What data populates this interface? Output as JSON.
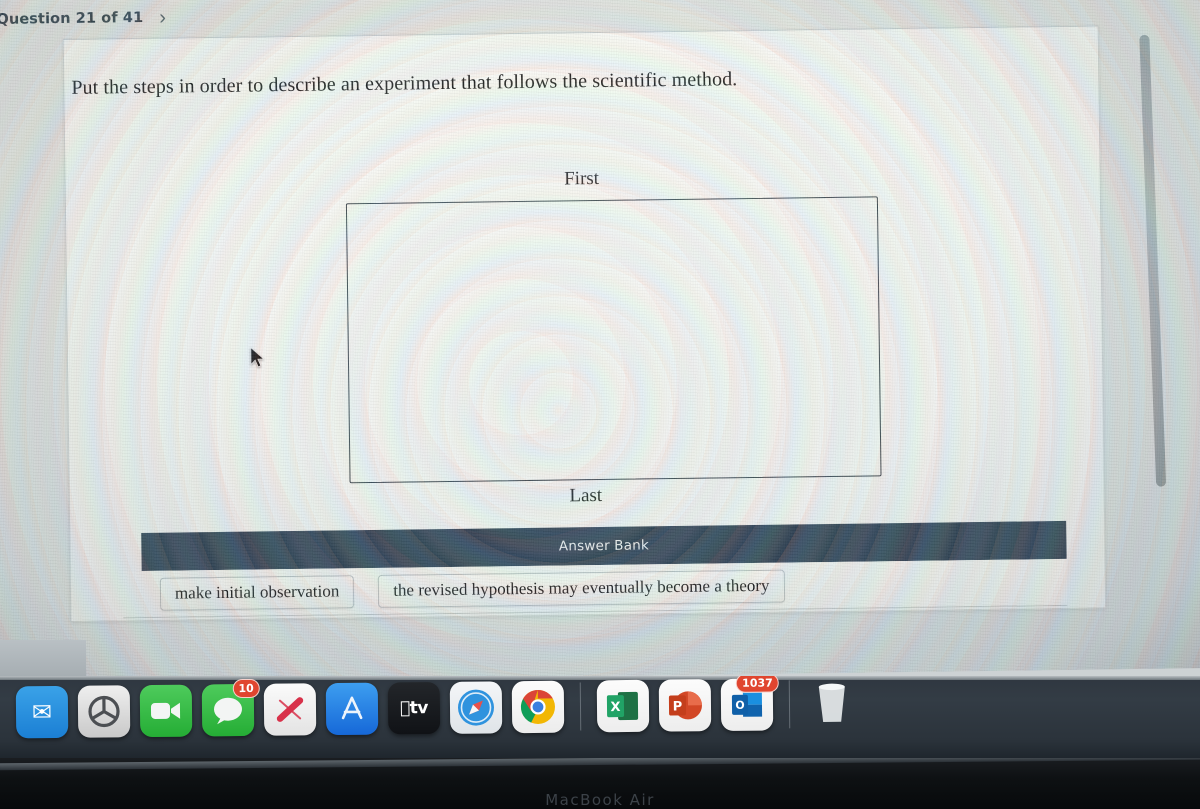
{
  "header": {
    "question_label": "Question 21 of 41",
    "next_icon": "chevron-right-icon"
  },
  "question": {
    "prompt": "Put the steps in order to describe an experiment that follows the scientific method.",
    "first_label": "First",
    "last_label": "Last",
    "dropzone_placeholder": ""
  },
  "answer_bank": {
    "title": "Answer Bank",
    "chips": [
      {
        "label": "make initial observation"
      },
      {
        "label": "the revised hypothesis may eventually become a theory"
      }
    ]
  },
  "colors": {
    "bank_header_bg": "#2c3f53",
    "bank_header_text": "#e9eef2",
    "dropzone_border": "#2f3a46",
    "accent_teal": "#126a78",
    "badge_red": "#e0452f"
  },
  "dock": {
    "items": [
      {
        "name": "mail-icon",
        "glyph": "✉",
        "badge": ""
      },
      {
        "name": "contacts-icon",
        "glyph": "◔",
        "badge": ""
      },
      {
        "name": "facetime-icon",
        "glyph": "▶",
        "badge": ""
      },
      {
        "name": "messages-icon",
        "glyph": "●",
        "badge": "10"
      },
      {
        "name": "news-icon",
        "glyph": "N",
        "badge": ""
      },
      {
        "name": "app-store-icon",
        "glyph": "A",
        "badge": ""
      },
      {
        "name": "apple-tv-icon",
        "glyph": "tv",
        "badge": ""
      },
      {
        "name": "safari-icon",
        "glyph": "✦",
        "badge": ""
      },
      {
        "name": "chrome-icon",
        "glyph": "●",
        "badge": ""
      },
      {
        "name": "excel-icon",
        "glyph": "X",
        "badge": ""
      },
      {
        "name": "powerpoint-icon",
        "glyph": "P",
        "badge": ""
      },
      {
        "name": "outlook-icon",
        "glyph": "O",
        "badge": "1037"
      },
      {
        "name": "trash-icon",
        "glyph": "",
        "badge": ""
      }
    ]
  },
  "device": {
    "model_text": "MacBook Air"
  }
}
